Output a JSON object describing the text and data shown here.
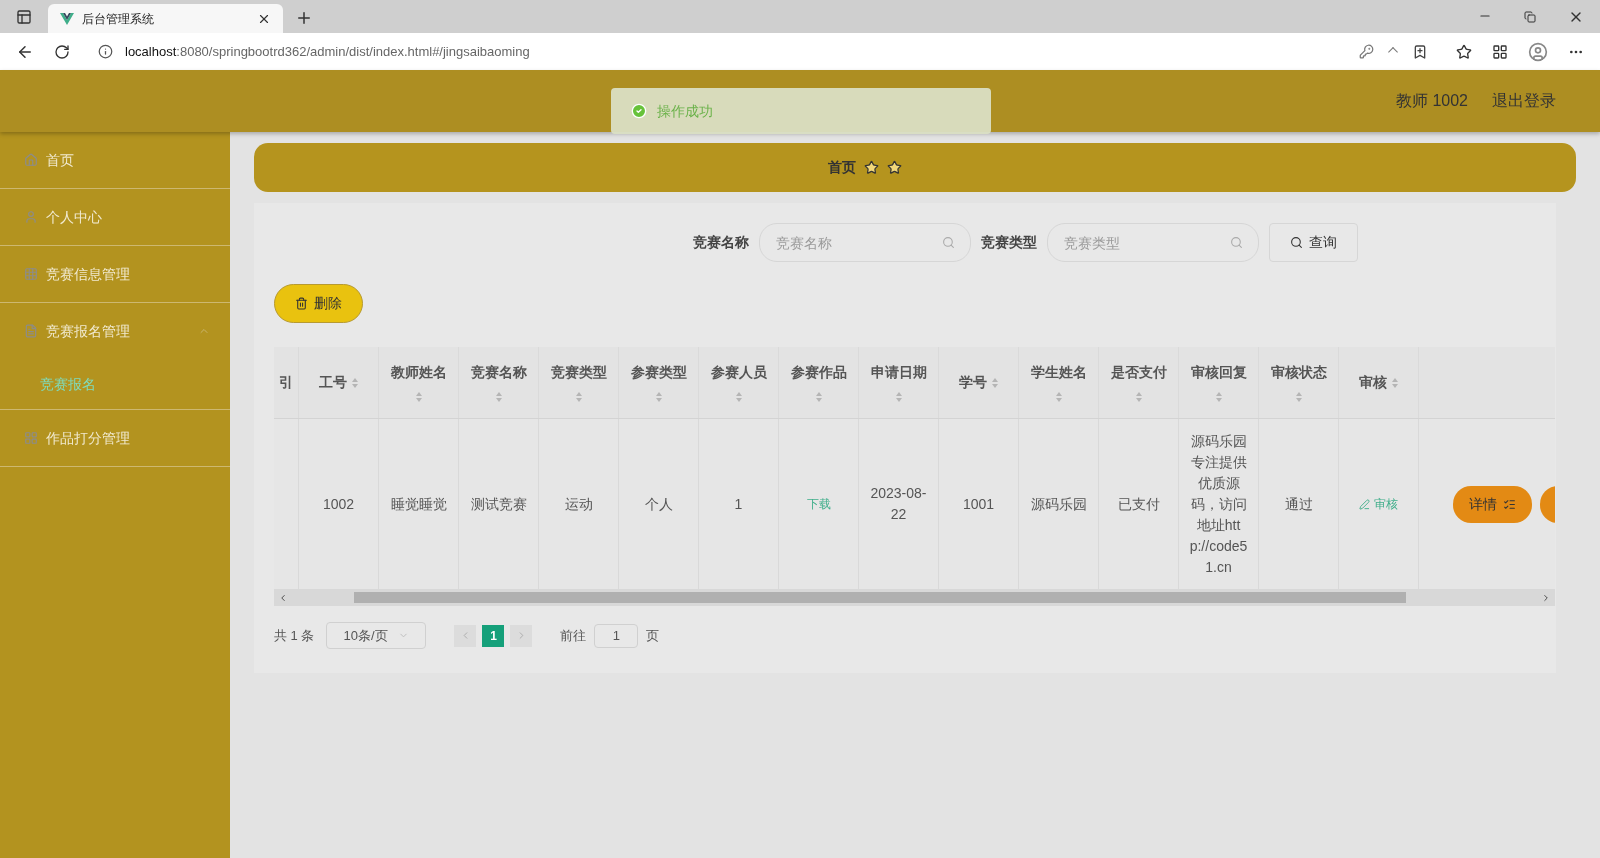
{
  "browser": {
    "tab_title": "后台管理系统",
    "url_host": "localhost",
    "url_rest": ":8080/springbootrd362/admin/dist/index.html#/jingsaibaoming"
  },
  "header": {
    "user": "教师 1002",
    "logout": "退出登录"
  },
  "toast": {
    "message": "操作成功"
  },
  "sidebar": {
    "items": [
      {
        "label": "首页",
        "selected": false
      },
      {
        "label": "个人中心",
        "selected": false
      },
      {
        "label": "竞赛信息管理",
        "selected": false
      },
      {
        "label": "竞赛报名管理",
        "selected": false,
        "expanded": true,
        "children": [
          {
            "label": "竞赛报名",
            "selected": true
          }
        ]
      },
      {
        "label": "作品打分管理",
        "selected": false
      }
    ]
  },
  "breadcrumb": {
    "items": [
      "首页"
    ]
  },
  "search": {
    "fields": [
      {
        "label": "竞赛名称",
        "placeholder": "竞赛名称"
      },
      {
        "label": "竞赛类型",
        "placeholder": "竞赛类型"
      }
    ],
    "button": "查询"
  },
  "delete_button": "删除",
  "table": {
    "columns": [
      {
        "label": "引",
        "sortable": false
      },
      {
        "label": "工号",
        "sortable": true
      },
      {
        "label": "教师姓名",
        "sortable": true
      },
      {
        "label": "竞赛名称",
        "sortable": true
      },
      {
        "label": "竞赛类型",
        "sortable": true
      },
      {
        "label": "参赛类型",
        "sortable": true
      },
      {
        "label": "参赛人员",
        "sortable": true
      },
      {
        "label": "参赛作品",
        "sortable": true
      },
      {
        "label": "申请日期",
        "sortable": true
      },
      {
        "label": "学号",
        "sortable": true
      },
      {
        "label": "学生姓名",
        "sortable": true
      },
      {
        "label": "是否支付",
        "sortable": true
      },
      {
        "label": "审核回复",
        "sortable": true
      },
      {
        "label": "审核状态",
        "sortable": true
      },
      {
        "label": "审核",
        "sortable": true
      }
    ],
    "rows": [
      {
        "cells": [
          {
            "kind": "blank"
          },
          {
            "kind": "text",
            "text": "1002"
          },
          {
            "kind": "text",
            "text": "睡觉睡觉"
          },
          {
            "kind": "text",
            "text": "测试竞赛"
          },
          {
            "kind": "text",
            "text": "运动"
          },
          {
            "kind": "text",
            "text": "个人"
          },
          {
            "kind": "text",
            "text": "1"
          },
          {
            "kind": "link",
            "text": "下载"
          },
          {
            "kind": "text",
            "text": "2023-08-22"
          },
          {
            "kind": "text",
            "text": "1001"
          },
          {
            "kind": "text",
            "text": "源码乐园"
          },
          {
            "kind": "text",
            "text": "已支付"
          },
          {
            "kind": "text",
            "text": "源码乐园专注提供优质源码，访问地址http://code51.cn"
          },
          {
            "kind": "text",
            "text": "通过"
          },
          {
            "kind": "review",
            "text": "审核"
          },
          {
            "kind": "actions",
            "buttons": [
              "详情"
            ],
            "overflow_button": true
          }
        ]
      }
    ]
  },
  "pagination": {
    "total": "共 1 条",
    "page_size": "10条/页",
    "pages": [
      {
        "label": "1",
        "selected": true
      }
    ],
    "goto_label": "前往",
    "goto_value": "1",
    "goto_suffix": "页"
  }
}
